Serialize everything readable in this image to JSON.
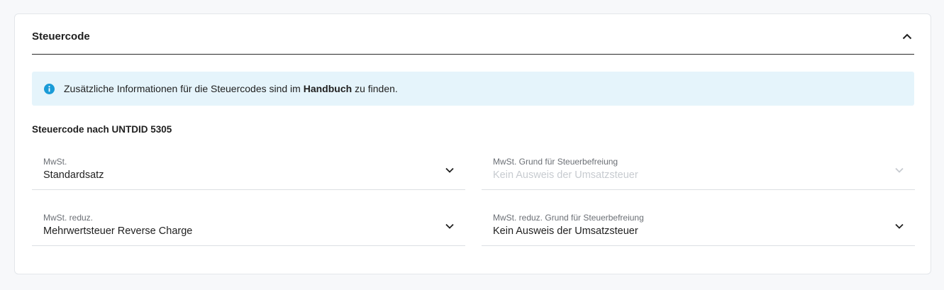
{
  "card": {
    "title": "Steuercode"
  },
  "info": {
    "text_before": "Zusätzliche Informationen für die Steuercodes sind im ",
    "link_text": "Handbuch",
    "text_after": " zu finden.",
    "icon": "info-icon"
  },
  "section": {
    "label": "Steuercode nach UNTDID 5305"
  },
  "fields": [
    {
      "label": "MwSt.",
      "value": "Standardsatz",
      "disabled": false
    },
    {
      "label": "MwSt. Grund für Steuerbefreiung",
      "value": "Kein Ausweis der Umsatzsteuer",
      "disabled": true
    },
    {
      "label": "MwSt. reduz.",
      "value": "Mehrwertsteuer Reverse Charge",
      "disabled": false
    },
    {
      "label": "MwSt. reduz. Grund für Steuerbefreiung",
      "value": "Kein Ausweis der Umsatzsteuer",
      "disabled": false
    }
  ],
  "colors": {
    "info_background": "#e5f4fb",
    "info_icon": "#1a9bd7",
    "disabled_text": "#c7cbd0"
  }
}
